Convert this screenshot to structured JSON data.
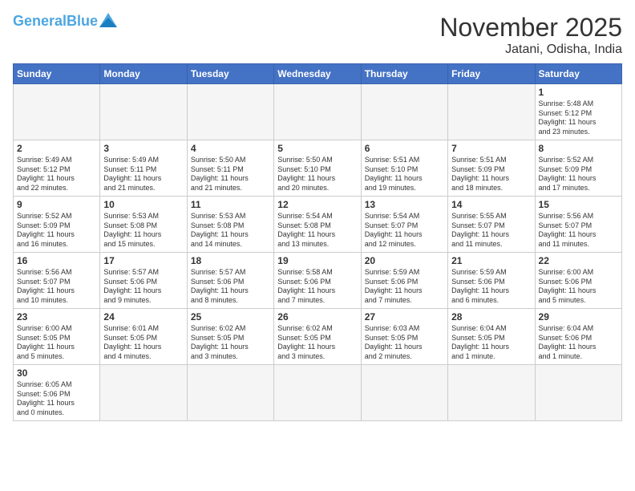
{
  "header": {
    "logo_general": "General",
    "logo_blue": "Blue",
    "month_title": "November 2025",
    "location": "Jatani, Odisha, India"
  },
  "weekdays": [
    "Sunday",
    "Monday",
    "Tuesday",
    "Wednesday",
    "Thursday",
    "Friday",
    "Saturday"
  ],
  "weeks": [
    [
      {
        "day": "",
        "info": ""
      },
      {
        "day": "",
        "info": ""
      },
      {
        "day": "",
        "info": ""
      },
      {
        "day": "",
        "info": ""
      },
      {
        "day": "",
        "info": ""
      },
      {
        "day": "",
        "info": ""
      },
      {
        "day": "1",
        "info": "Sunrise: 5:48 AM\nSunset: 5:12 PM\nDaylight: 11 hours\nand 23 minutes."
      }
    ],
    [
      {
        "day": "2",
        "info": "Sunrise: 5:49 AM\nSunset: 5:12 PM\nDaylight: 11 hours\nand 22 minutes."
      },
      {
        "day": "3",
        "info": "Sunrise: 5:49 AM\nSunset: 5:11 PM\nDaylight: 11 hours\nand 21 minutes."
      },
      {
        "day": "4",
        "info": "Sunrise: 5:50 AM\nSunset: 5:11 PM\nDaylight: 11 hours\nand 21 minutes."
      },
      {
        "day": "5",
        "info": "Sunrise: 5:50 AM\nSunset: 5:10 PM\nDaylight: 11 hours\nand 20 minutes."
      },
      {
        "day": "6",
        "info": "Sunrise: 5:51 AM\nSunset: 5:10 PM\nDaylight: 11 hours\nand 19 minutes."
      },
      {
        "day": "7",
        "info": "Sunrise: 5:51 AM\nSunset: 5:09 PM\nDaylight: 11 hours\nand 18 minutes."
      },
      {
        "day": "8",
        "info": "Sunrise: 5:52 AM\nSunset: 5:09 PM\nDaylight: 11 hours\nand 17 minutes."
      }
    ],
    [
      {
        "day": "9",
        "info": "Sunrise: 5:52 AM\nSunset: 5:09 PM\nDaylight: 11 hours\nand 16 minutes."
      },
      {
        "day": "10",
        "info": "Sunrise: 5:53 AM\nSunset: 5:08 PM\nDaylight: 11 hours\nand 15 minutes."
      },
      {
        "day": "11",
        "info": "Sunrise: 5:53 AM\nSunset: 5:08 PM\nDaylight: 11 hours\nand 14 minutes."
      },
      {
        "day": "12",
        "info": "Sunrise: 5:54 AM\nSunset: 5:08 PM\nDaylight: 11 hours\nand 13 minutes."
      },
      {
        "day": "13",
        "info": "Sunrise: 5:54 AM\nSunset: 5:07 PM\nDaylight: 11 hours\nand 12 minutes."
      },
      {
        "day": "14",
        "info": "Sunrise: 5:55 AM\nSunset: 5:07 PM\nDaylight: 11 hours\nand 11 minutes."
      },
      {
        "day": "15",
        "info": "Sunrise: 5:56 AM\nSunset: 5:07 PM\nDaylight: 11 hours\nand 11 minutes."
      }
    ],
    [
      {
        "day": "16",
        "info": "Sunrise: 5:56 AM\nSunset: 5:07 PM\nDaylight: 11 hours\nand 10 minutes."
      },
      {
        "day": "17",
        "info": "Sunrise: 5:57 AM\nSunset: 5:06 PM\nDaylight: 11 hours\nand 9 minutes."
      },
      {
        "day": "18",
        "info": "Sunrise: 5:57 AM\nSunset: 5:06 PM\nDaylight: 11 hours\nand 8 minutes."
      },
      {
        "day": "19",
        "info": "Sunrise: 5:58 AM\nSunset: 5:06 PM\nDaylight: 11 hours\nand 7 minutes."
      },
      {
        "day": "20",
        "info": "Sunrise: 5:59 AM\nSunset: 5:06 PM\nDaylight: 11 hours\nand 7 minutes."
      },
      {
        "day": "21",
        "info": "Sunrise: 5:59 AM\nSunset: 5:06 PM\nDaylight: 11 hours\nand 6 minutes."
      },
      {
        "day": "22",
        "info": "Sunrise: 6:00 AM\nSunset: 5:06 PM\nDaylight: 11 hours\nand 5 minutes."
      }
    ],
    [
      {
        "day": "23",
        "info": "Sunrise: 6:00 AM\nSunset: 5:05 PM\nDaylight: 11 hours\nand 5 minutes."
      },
      {
        "day": "24",
        "info": "Sunrise: 6:01 AM\nSunset: 5:05 PM\nDaylight: 11 hours\nand 4 minutes."
      },
      {
        "day": "25",
        "info": "Sunrise: 6:02 AM\nSunset: 5:05 PM\nDaylight: 11 hours\nand 3 minutes."
      },
      {
        "day": "26",
        "info": "Sunrise: 6:02 AM\nSunset: 5:05 PM\nDaylight: 11 hours\nand 3 minutes."
      },
      {
        "day": "27",
        "info": "Sunrise: 6:03 AM\nSunset: 5:05 PM\nDaylight: 11 hours\nand 2 minutes."
      },
      {
        "day": "28",
        "info": "Sunrise: 6:04 AM\nSunset: 5:05 PM\nDaylight: 11 hours\nand 1 minute."
      },
      {
        "day": "29",
        "info": "Sunrise: 6:04 AM\nSunset: 5:06 PM\nDaylight: 11 hours\nand 1 minute."
      }
    ],
    [
      {
        "day": "30",
        "info": "Sunrise: 6:05 AM\nSunset: 5:06 PM\nDaylight: 11 hours\nand 0 minutes."
      },
      {
        "day": "",
        "info": ""
      },
      {
        "day": "",
        "info": ""
      },
      {
        "day": "",
        "info": ""
      },
      {
        "day": "",
        "info": ""
      },
      {
        "day": "",
        "info": ""
      },
      {
        "day": "",
        "info": ""
      }
    ]
  ]
}
